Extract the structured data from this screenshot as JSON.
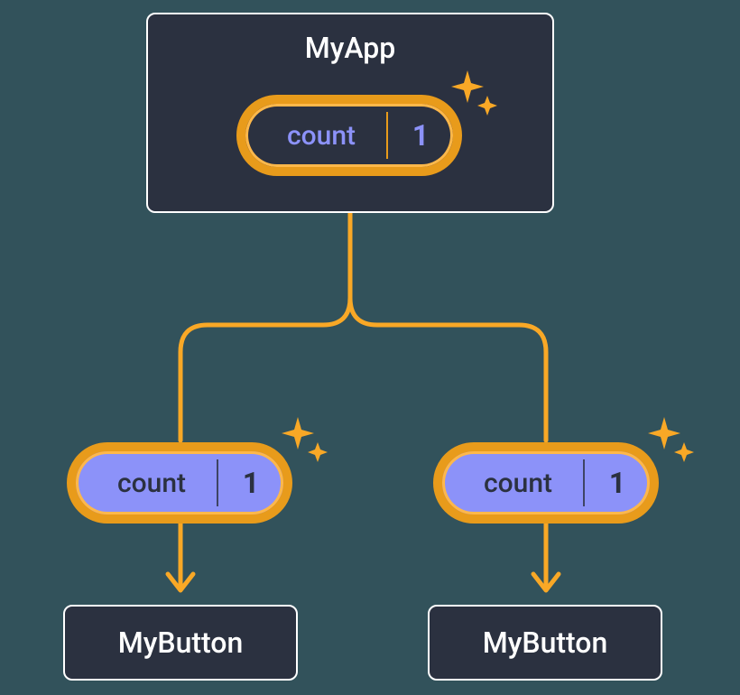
{
  "parent": {
    "title": "MyApp",
    "state": {
      "label": "count",
      "value": "1"
    }
  },
  "children": [
    {
      "props": {
        "label": "count",
        "value": "1"
      },
      "title": "MyButton"
    },
    {
      "props": {
        "label": "count",
        "value": "1"
      },
      "title": "MyButton"
    }
  ],
  "colors": {
    "accent": "#f9a826",
    "accentLight": "#ffb84a",
    "boxBg": "#2b3140",
    "propBg": "#8c92f9",
    "pageBg": "#32525b"
  }
}
